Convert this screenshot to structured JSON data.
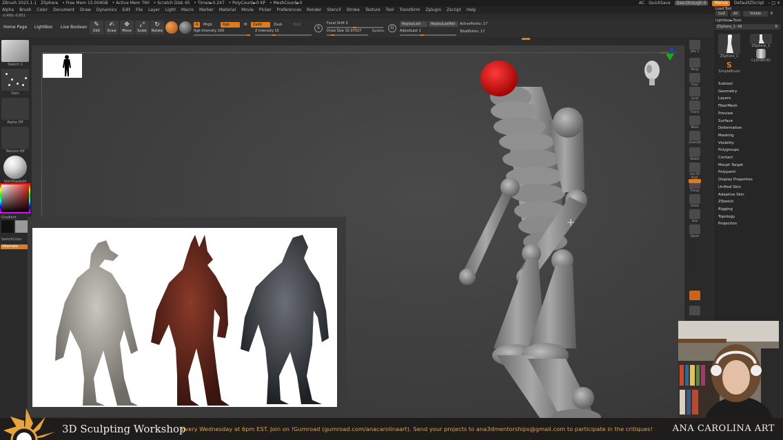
{
  "titlebar": {
    "items": [
      "ZBrush 2023.1.1",
      "ZSphere",
      "• Free Mem 15.004GB",
      "• Active Mem 790",
      "• Scratch Disk 45",
      "• Timer►0.247",
      "• PolyCount►0 KP",
      "• MeshCount►0"
    ],
    "ac": "AC",
    "quicksave": "QuickSave",
    "see_through": "See-through 0",
    "menus": "Menus",
    "script": "DefaultZScript",
    "win_controls": "– □ ×"
  },
  "menubar": {
    "items": [
      "Alpha",
      "Brush",
      "Color",
      "Document",
      "Draw",
      "Dynamics",
      "Edit",
      "File",
      "Layer",
      "Light",
      "Macro",
      "Marker",
      "Material",
      "Movie",
      "Picker",
      "Preferences",
      "Render",
      "Stencil",
      "Stroke",
      "Texture",
      "Tool",
      "Transform",
      "Zplugin",
      "Zscript",
      "Help"
    ]
  },
  "coords": "-0.489,-0.851",
  "toolbar": {
    "home_page": "Home Page",
    "lightbox": "LightBox",
    "live_boolean": "Live Boolean",
    "tools": [
      {
        "label": "Edit",
        "glyph": "✎",
        "active": true
      },
      {
        "label": "Draw",
        "glyph": "✍",
        "active": true
      },
      {
        "label": "Move",
        "glyph": "✥",
        "active": false
      },
      {
        "label": "Scale",
        "glyph": "⤢",
        "active": false
      },
      {
        "label": "Rotate",
        "glyph": "↻",
        "active": false
      }
    ],
    "a_chip": "A",
    "mrgb": "Mrgb",
    "rgb": "Rgb",
    "m": "M",
    "zadd": "Zadd",
    "zsub": "Zsub",
    "zcut": "Zcut",
    "rgb_intensity": "Rgb Intensity 100",
    "z_intensity": "Z Intensity 15",
    "focal_shift": "Focal Shift 0",
    "draw_size": "Draw Size 16.97027",
    "dynamic": "Dynamic",
    "replay_last": "ReplayLast",
    "replay_last_rel": "ReplayLastRel",
    "adjust_last": "AdjustLast 1",
    "active_points": "ActivePoints: 17",
    "total_points": "TotalPoints: 17"
  },
  "leftshelf": {
    "sketch": "Sketch 1",
    "dots": "Dots",
    "alpha_off": "Alpha Off",
    "texture_off": "Texture Off",
    "material": "SkinShaded4",
    "gradient": "Gradient",
    "switch_color": "SwitchColor",
    "alternate": "Alternate"
  },
  "righttray": {
    "items": [
      "SPix 3",
      "Persp",
      "Floor",
      "Local",
      "Frame",
      "Move",
      "Zoom3D",
      "Rotate",
      "Line Fill PolyF",
      "Transp",
      "Ghost",
      "Solo",
      "Xpose"
    ]
  },
  "toolpanel": {
    "load_tool": "Load Tool",
    "goz": "GoZ",
    "all": "All",
    "visible": "Visible",
    "r": "R",
    "lightbox_tools": "Lightbox►Tools",
    "current_tool": "ZSphere_1. 49",
    "r2": "R",
    "tools": [
      {
        "name": "ZSphere_1"
      },
      {
        "name": "ZSphere_1"
      },
      {
        "name": "SimpleBrush"
      },
      {
        "name": "Cylinder3D"
      }
    ],
    "subpalettes": [
      "Subtool",
      "Geometry",
      "Layers",
      "FiberMesh",
      "Preview",
      "Surface",
      "Deformation",
      "Masking",
      "Visibility",
      "Polygroups",
      "Contact",
      "Morph Target",
      "Polypaint",
      "Display Properties",
      "Unified Skin",
      "Adaptive Skin",
      "ZSketch",
      "Rigging",
      "Topology",
      "Projection"
    ]
  },
  "banner": {
    "title": "3D Sculpting Workshop",
    "message": "Every Wednesday at 6pm EST. Join on !Gumroad (gumroad.com/anacarolinaart). Send your projects to ana3dmentorships@gmail.com to participate in the critiques!",
    "brand": "ANA CAROLINA ART"
  },
  "colors": {
    "accent": "#e07a1f",
    "head_red": "#d81414",
    "banner_text": "#e8a33a"
  }
}
